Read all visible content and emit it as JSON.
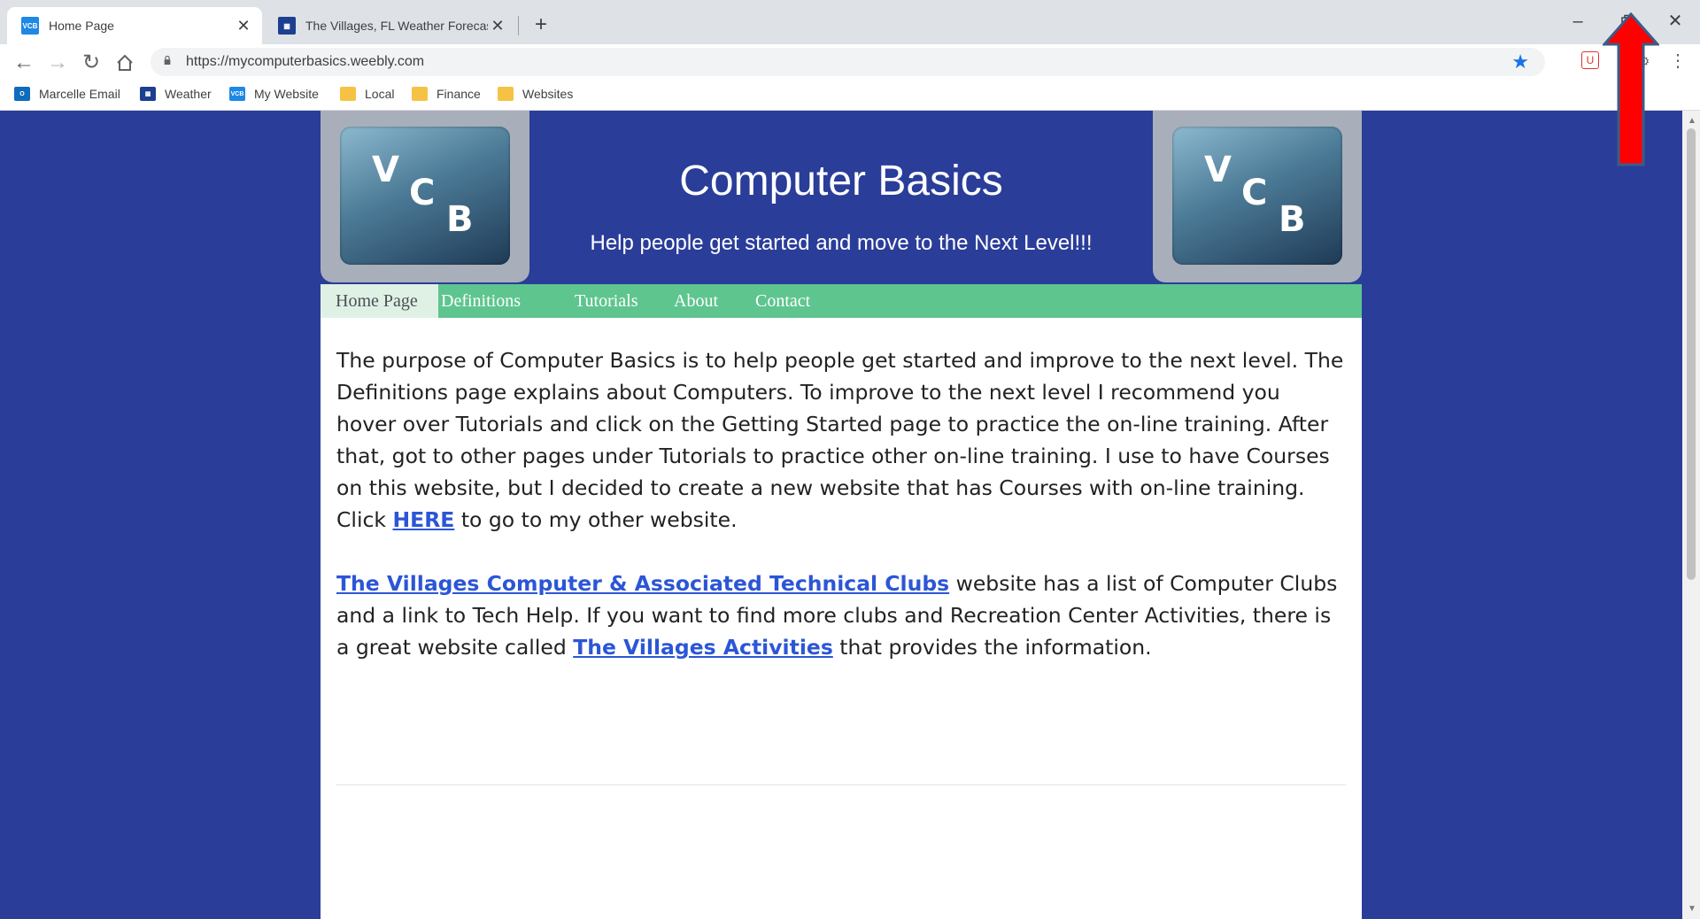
{
  "browser": {
    "tabs": [
      {
        "title": "Home Page",
        "favicon": "vcb-favicon",
        "active": true
      },
      {
        "title": "The Villages, FL Weather Forecast",
        "favicon": "weather-favicon",
        "active": false
      }
    ],
    "url": "https://mycomputerbasics.weebly.com",
    "bookmarks": [
      {
        "label": "Marcelle Email",
        "icon": "outlook-icon"
      },
      {
        "label": "Weather",
        "icon": "weather-icon"
      },
      {
        "label": "My Website",
        "icon": "vcb-icon"
      },
      {
        "label": "Local",
        "icon": "folder-icon"
      },
      {
        "label": "Finance",
        "icon": "folder-icon"
      },
      {
        "label": "Websites",
        "icon": "folder-icon"
      }
    ]
  },
  "site": {
    "logo_letters": [
      "V",
      "C",
      "B"
    ],
    "title": "Computer Basics",
    "tagline": "Help people get started and move to the Next Level!!!",
    "nav": [
      "Home Page",
      "Definitions",
      "Tutorials",
      "About",
      "Contact"
    ],
    "active_nav": "Home Page",
    "paragraph1": {
      "text_before": "The purpose of Computer Basics is to help people get started and improve to the next level. The Definitions page explains about Computers.  To improve to the next level I recommend you hover over Tutorials and click on the Getting Started page to practice the on-line training.  After that, got to other pages under Tutorials to practice other on-line training.  I use to have Courses on this website, but I decided to create a new website that has Courses with on-line training.  Click ",
      "link": "HERE",
      "text_after": " to go to my other website."
    },
    "paragraph2": {
      "link1": "The Villages Computer & Associated Technical Clubs",
      "text_mid1": " website has a list of Computer Clubs and a link to Tech Help.  If you want to find more clubs and Recreation Center Activities, there is a great website called ",
      "link2": "The Villages Activities",
      "text_after": " that provides the information."
    }
  },
  "colors": {
    "page_background": "#2a3d99",
    "nav_green": "#5ec58e",
    "link_blue": "#2b56d6",
    "annotation_red": "#ff0000"
  }
}
